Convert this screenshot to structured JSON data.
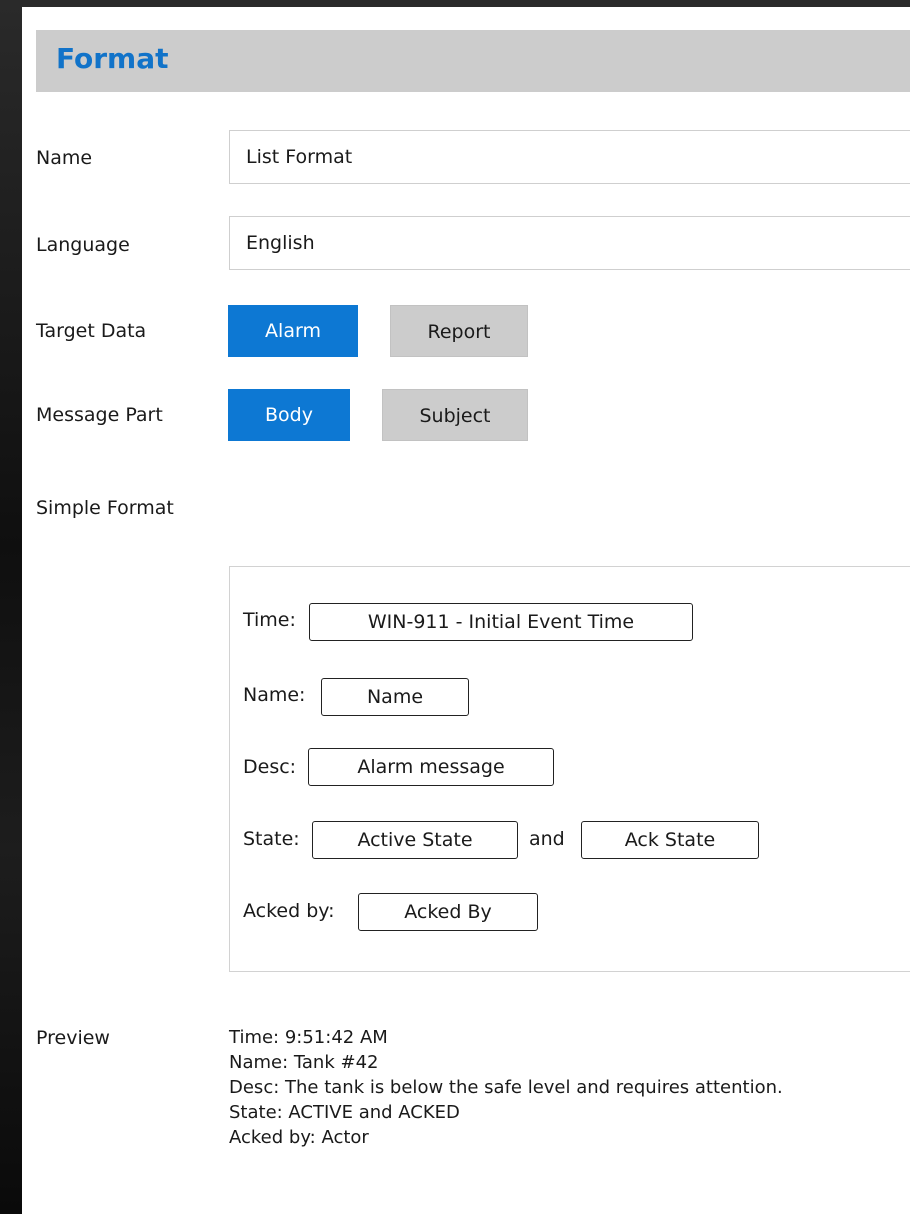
{
  "header": {
    "title": "Format"
  },
  "form": {
    "name_label": "Name",
    "name_value": "List Format",
    "language_label": "Language",
    "language_value": "English",
    "target_data_label": "Target Data",
    "target_data_options": [
      "Alarm",
      "Report"
    ],
    "target_data_selected": "Alarm",
    "message_part_label": "Message Part",
    "message_part_options": [
      "Body",
      "Subject"
    ],
    "message_part_selected": "Body",
    "simple_format_label": "Simple Format"
  },
  "simple_format": {
    "time_label": "Time:",
    "time_token": "WIN-911 - Initial Event Time",
    "name_label": "Name:",
    "name_token": "Name",
    "desc_label": "Desc:",
    "desc_token": "Alarm message",
    "state_label": "State:",
    "state_token": "Active State",
    "and_text": "and",
    "ack_token": "Ack State",
    "acked_by_label": "Acked by:",
    "acked_by_token": "Acked By"
  },
  "preview": {
    "label": "Preview",
    "lines": [
      "Time: 9:51:42 AM",
      "Name: Tank #42",
      "Desc: The tank is below the safe level and requires attention.",
      "State: ACTIVE and ACKED",
      "Acked by: Actor"
    ]
  },
  "colors": {
    "accent": "#0d78d3",
    "title": "#1173c9",
    "header_bg": "#cccccc",
    "inactive_toggle": "#cccccc"
  }
}
